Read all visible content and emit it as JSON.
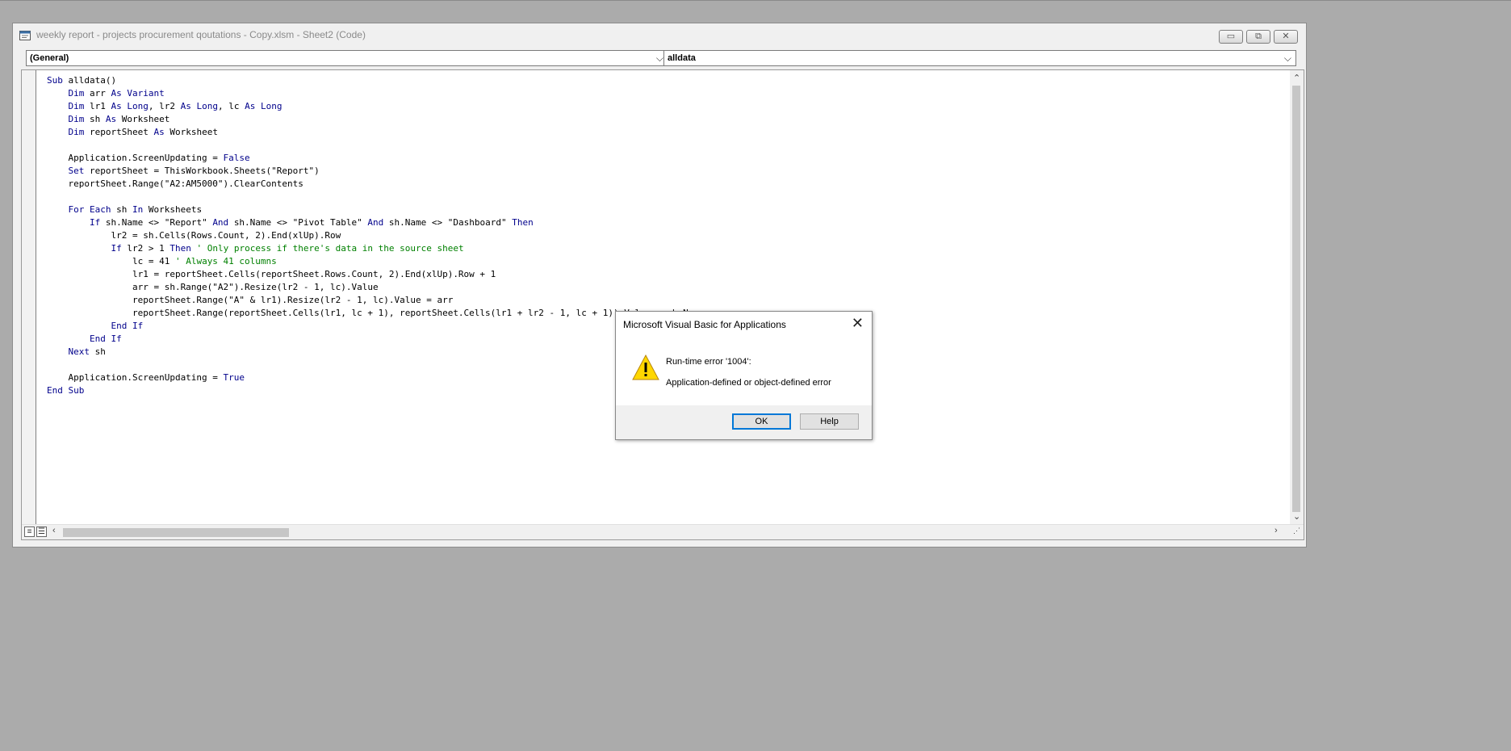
{
  "window": {
    "title": "weekly report - projects  procurement qoutations - Copy.xlsm - Sheet2 (Code)",
    "controls": {
      "minimize": "▭",
      "restore": "⧉",
      "close": "✕"
    }
  },
  "dropdowns": {
    "object": {
      "value": "(General)"
    },
    "procedure": {
      "value": "alldata"
    }
  },
  "code": {
    "lines": [
      [
        {
          "t": "kw",
          "v": "Sub "
        },
        {
          "t": "tx",
          "v": "alldata()"
        }
      ],
      [
        {
          "t": "tx",
          "v": "    "
        },
        {
          "t": "kw",
          "v": "Dim "
        },
        {
          "t": "tx",
          "v": "arr "
        },
        {
          "t": "kw",
          "v": "As Variant"
        }
      ],
      [
        {
          "t": "tx",
          "v": "    "
        },
        {
          "t": "kw",
          "v": "Dim "
        },
        {
          "t": "tx",
          "v": "lr1 "
        },
        {
          "t": "kw",
          "v": "As Long"
        },
        {
          "t": "tx",
          "v": ", lr2 "
        },
        {
          "t": "kw",
          "v": "As Long"
        },
        {
          "t": "tx",
          "v": ", lc "
        },
        {
          "t": "kw",
          "v": "As Long"
        }
      ],
      [
        {
          "t": "tx",
          "v": "    "
        },
        {
          "t": "kw",
          "v": "Dim "
        },
        {
          "t": "tx",
          "v": "sh "
        },
        {
          "t": "kw",
          "v": "As "
        },
        {
          "t": "tx",
          "v": "Worksheet"
        }
      ],
      [
        {
          "t": "tx",
          "v": "    "
        },
        {
          "t": "kw",
          "v": "Dim "
        },
        {
          "t": "tx",
          "v": "reportSheet "
        },
        {
          "t": "kw",
          "v": "As "
        },
        {
          "t": "tx",
          "v": "Worksheet"
        }
      ],
      [],
      [
        {
          "t": "tx",
          "v": "    Application.ScreenUpdating = "
        },
        {
          "t": "kw",
          "v": "False"
        }
      ],
      [
        {
          "t": "tx",
          "v": "    "
        },
        {
          "t": "kw",
          "v": "Set "
        },
        {
          "t": "tx",
          "v": "reportSheet = ThisWorkbook.Sheets(\"Report\")"
        }
      ],
      [
        {
          "t": "tx",
          "v": "    reportSheet.Range(\"A2:AM5000\").ClearContents"
        }
      ],
      [],
      [
        {
          "t": "tx",
          "v": "    "
        },
        {
          "t": "kw",
          "v": "For Each "
        },
        {
          "t": "tx",
          "v": "sh "
        },
        {
          "t": "kw",
          "v": "In "
        },
        {
          "t": "tx",
          "v": "Worksheets"
        }
      ],
      [
        {
          "t": "tx",
          "v": "        "
        },
        {
          "t": "kw",
          "v": "If "
        },
        {
          "t": "tx",
          "v": "sh.Name <> \"Report\" "
        },
        {
          "t": "kw",
          "v": "And "
        },
        {
          "t": "tx",
          "v": "sh.Name <> \"Pivot Table\" "
        },
        {
          "t": "kw",
          "v": "And "
        },
        {
          "t": "tx",
          "v": "sh.Name <> \"Dashboard\" "
        },
        {
          "t": "kw",
          "v": "Then"
        }
      ],
      [
        {
          "t": "tx",
          "v": "            lr2 = sh.Cells(Rows.Count, 2).End(xlUp).Row"
        }
      ],
      [
        {
          "t": "tx",
          "v": "            "
        },
        {
          "t": "kw",
          "v": "If "
        },
        {
          "t": "tx",
          "v": "lr2 > 1 "
        },
        {
          "t": "kw",
          "v": "Then "
        },
        {
          "t": "cm",
          "v": "' Only process if there's data in the source sheet"
        }
      ],
      [
        {
          "t": "tx",
          "v": "                lc = 41 "
        },
        {
          "t": "cm",
          "v": "' Always 41 columns"
        }
      ],
      [
        {
          "t": "tx",
          "v": "                lr1 = reportSheet.Cells(reportSheet.Rows.Count, 2).End(xlUp).Row + 1"
        }
      ],
      [
        {
          "t": "tx",
          "v": "                arr = sh.Range(\"A2\").Resize(lr2 - 1, lc).Value"
        }
      ],
      [
        {
          "t": "tx",
          "v": "                reportSheet.Range(\"A\" & lr1).Resize(lr2 - 1, lc).Value = arr"
        }
      ],
      [
        {
          "t": "tx",
          "v": "                reportSheet.Range(reportSheet.Cells(lr1, lc + 1), reportSheet.Cells(lr1 + lr2 - 1, lc + 1)).Value = sh.Name"
        }
      ],
      [
        {
          "t": "tx",
          "v": "            "
        },
        {
          "t": "kw",
          "v": "End If"
        }
      ],
      [
        {
          "t": "tx",
          "v": "        "
        },
        {
          "t": "kw",
          "v": "End If"
        }
      ],
      [
        {
          "t": "tx",
          "v": "    "
        },
        {
          "t": "kw",
          "v": "Next "
        },
        {
          "t": "tx",
          "v": "sh"
        }
      ],
      [],
      [
        {
          "t": "tx",
          "v": "    Application.ScreenUpdating = "
        },
        {
          "t": "kw",
          "v": "True"
        }
      ],
      [
        {
          "t": "kw",
          "v": "End Sub"
        }
      ]
    ]
  },
  "dialog": {
    "title": "Microsoft Visual Basic for Applications",
    "close": "✕",
    "icon": "warning-icon",
    "error_line": "Run-time error '1004':",
    "message": "Application-defined or object-defined error",
    "ok_label": "OK",
    "help_label": "Help"
  },
  "colors": {
    "keyword": "#00008b",
    "comment": "#008000",
    "desktop": "#ababab",
    "default_button_border": "#0078d7"
  }
}
